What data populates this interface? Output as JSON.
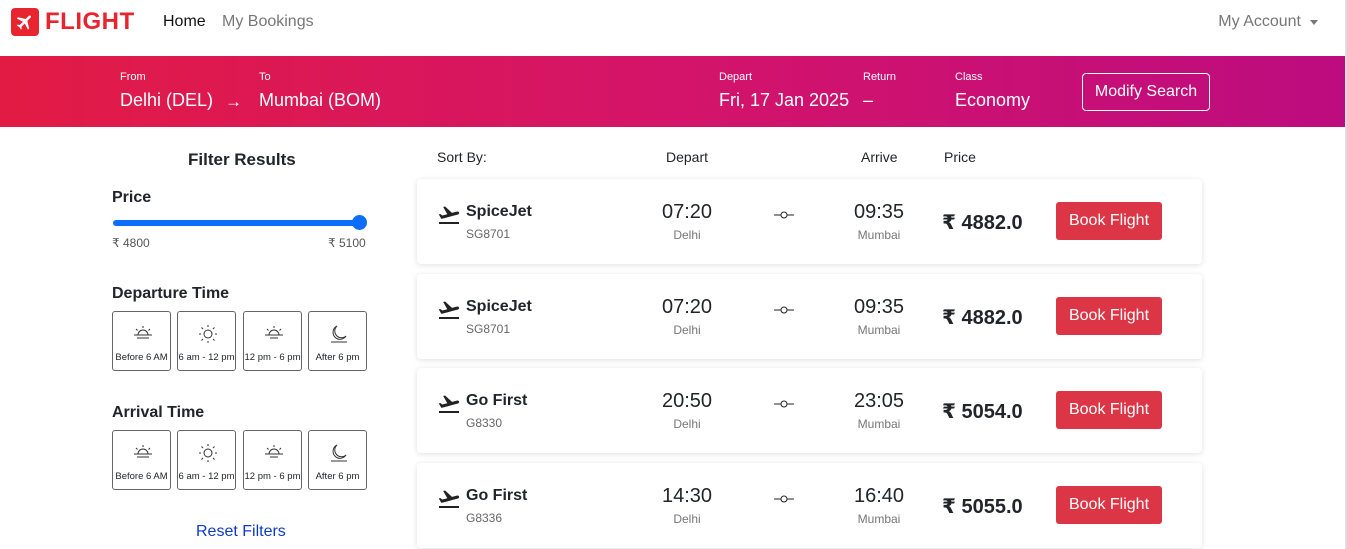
{
  "navbar": {
    "brand": "FLIGHT",
    "home": "Home",
    "bookings": "My Bookings",
    "account": "My Account"
  },
  "search": {
    "from_label": "From",
    "from_value": "Delhi (DEL)",
    "arrow": "→",
    "to_label": "To",
    "to_value": "Mumbai (BOM)",
    "depart_label": "Depart",
    "depart_value": "Fri, 17 Jan 2025",
    "return_label": "Return",
    "return_value": "–",
    "class_label": "Class",
    "class_value": "Economy",
    "modify_button": "Modify Search"
  },
  "filters": {
    "title": "Filter Results",
    "price_label": "Price",
    "price_min": "₹ 4800",
    "price_max": "₹ 5100",
    "price_slider_fraction": 1.0,
    "departure_label": "Departure Time",
    "arrival_label": "Arrival Time",
    "time_options": [
      {
        "label": "Before 6 AM",
        "icon": "sunrise-icon"
      },
      {
        "label": "6 am - 12 pm",
        "icon": "sun-icon"
      },
      {
        "label": "12 pm - 6 pm",
        "icon": "sunset-icon"
      },
      {
        "label": "After 6 pm",
        "icon": "moon-icon"
      }
    ],
    "reset": "Reset Filters"
  },
  "sort": {
    "sort_by": "Sort By:",
    "depart": "Depart",
    "arrive": "Arrive",
    "price": "Price"
  },
  "flights": [
    {
      "airline": "SpiceJet",
      "code": "SG8701",
      "dep_time": "07:20",
      "dep_city": "Delhi",
      "arr_time": "09:35",
      "arr_city": "Mumbai",
      "price": "₹ 4882.0",
      "button": "Book Flight"
    },
    {
      "airline": "SpiceJet",
      "code": "SG8701",
      "dep_time": "07:20",
      "dep_city": "Delhi",
      "arr_time": "09:35",
      "arr_city": "Mumbai",
      "price": "₹ 4882.0",
      "button": "Book Flight"
    },
    {
      "airline": "Go First",
      "code": "G8330",
      "dep_time": "20:50",
      "dep_city": "Delhi",
      "arr_time": "23:05",
      "arr_city": "Mumbai",
      "price": "₹ 5054.0",
      "button": "Book Flight"
    },
    {
      "airline": "Go First",
      "code": "G8336",
      "dep_time": "14:30",
      "dep_city": "Delhi",
      "arr_time": "16:40",
      "arr_city": "Mumbai",
      "price": "₹ 5055.0",
      "button": "Book Flight"
    }
  ],
  "colors": {
    "brand": "#e8242f",
    "banner_start": "#e21b44",
    "banner_end": "#bd0c7f",
    "book_button": "#dc3545",
    "slider": "#0d6efd"
  }
}
